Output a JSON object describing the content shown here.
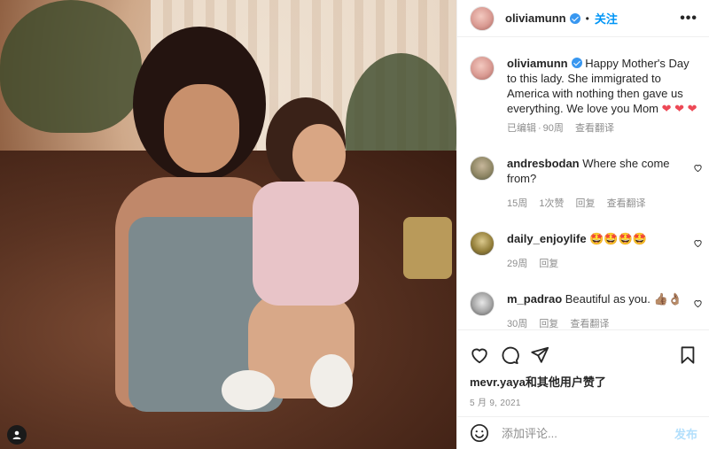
{
  "post": {
    "author": "oliviamunn",
    "follow_label": "关注",
    "more_label": "•••",
    "dot": "•"
  },
  "caption": {
    "username": "oliviamunn",
    "text": "Happy Mother's Day to this lady. She immigrated to America with nothing then gave us everything. We love you Mom",
    "hearts": "❤ ❤ ❤",
    "edited": "已编辑",
    "sep": "·",
    "age": "90周",
    "translate": "查看翻译"
  },
  "comments": [
    {
      "username": "andresbodan",
      "text": "Where she come from?",
      "age": "15周",
      "likes": "1次赞",
      "reply": "回复",
      "translate": "查看翻译"
    },
    {
      "username": "daily_enjoylife",
      "text": "🤩🤩🤩🤩",
      "age": "29周",
      "reply": "回复"
    },
    {
      "username": "m_padrao",
      "text": "Beautiful as you. 👍🏽👌🏽",
      "age": "30周",
      "reply": "回复",
      "translate": "查看翻译"
    }
  ],
  "likes": {
    "user": "mevr.yaya",
    "rest": "和其他用户赞了"
  },
  "date": "5 月 9, 2021",
  "add_comment": {
    "placeholder": "添加评论...",
    "post_label": "发布"
  },
  "icons": {
    "like": "heart-icon",
    "comment": "comment-icon",
    "share": "share-icon",
    "save": "bookmark-icon",
    "emoji": "emoji-icon",
    "tag": "user-tag-icon"
  },
  "colors": {
    "link": "#0095f6",
    "verified": "#3897f0",
    "muted": "#8e8e8e",
    "heart": "#ed4956",
    "post_disabled": "#b2dffc"
  }
}
